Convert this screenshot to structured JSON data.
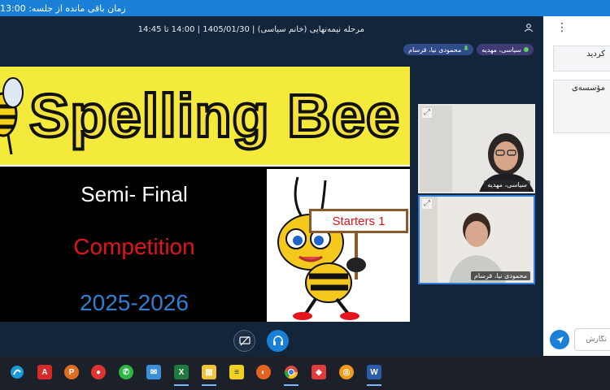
{
  "banner": {
    "text": "زمان باقی مانده از جلسه: 13:00"
  },
  "session": {
    "title": "مرحله نیمه‌نهایی (خانم سیاسی) | 1405/01/30 | 14:00 تا 14:45"
  },
  "participants": {
    "tags": [
      {
        "name": "سیاسی، مهدیه"
      },
      {
        "name": "محمودی نیا، قرسام"
      }
    ],
    "videos": [
      {
        "name": "سیاسی، مهدیه"
      },
      {
        "name": "محمودی نیا، قرسام"
      }
    ]
  },
  "slide": {
    "banner_word": "Spelling Bee",
    "line1": "Semi- Final",
    "line2": "Competition",
    "line3": "2025-2026",
    "sign": "Starters 1"
  },
  "chat": {
    "messages": [
      "کردید",
      "مؤسسه‌ی"
    ],
    "input_placeholder": "نگارش"
  },
  "icons": {
    "more": "more-vertical-icon",
    "user": "user-icon",
    "expand": "expand-icon",
    "screen_share": "screen-share-off-icon",
    "headset": "headset-icon",
    "send": "send-icon"
  },
  "colors": {
    "banner": "#1a7fd6",
    "main_bg": "#13253b",
    "accent": "#1a7fd6",
    "competition_text": "#e3141a",
    "year_text": "#2d7fd1"
  }
}
